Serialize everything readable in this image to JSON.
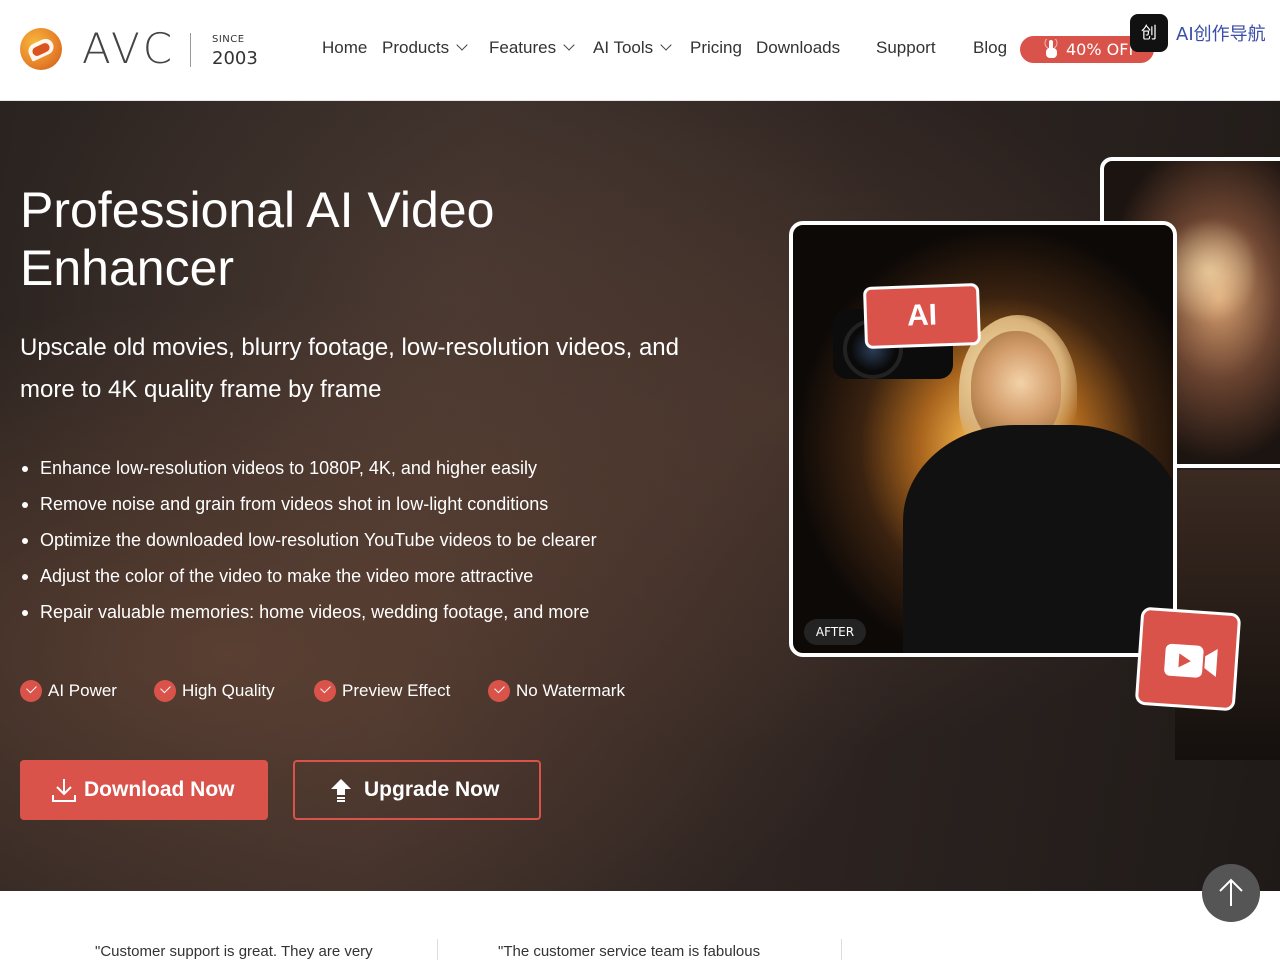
{
  "header": {
    "brand": "AVC",
    "since_label": "SINCE",
    "since_year": "2003",
    "nav": [
      {
        "label": "Home",
        "dropdown": false
      },
      {
        "label": "Products",
        "dropdown": true
      },
      {
        "label": "Features",
        "dropdown": true
      },
      {
        "label": "AI Tools",
        "dropdown": true
      },
      {
        "label": "Pricing",
        "dropdown": false
      },
      {
        "label": "Downloads",
        "dropdown": false
      },
      {
        "label": "Support",
        "dropdown": false
      },
      {
        "label": "Blog",
        "dropdown": false
      }
    ],
    "promo_label": "40% OFF",
    "partner_logo_text": "创",
    "partner_text": "AI创作导航"
  },
  "hero": {
    "title": "Professional AI Video Enhancer",
    "subtitle": "Upscale old movies, blurry footage, low-resolution videos, and more to 4K quality frame by frame",
    "bullets": [
      "Enhance low-resolution videos to 1080P, 4K, and higher easily",
      "Remove noise and grain from videos shot in low-light conditions",
      "Optimize the downloaded low-resolution YouTube videos to be clearer",
      "Adjust the color of the video to make the video more attractive",
      "Repair valuable memories: home videos, wedding footage, and more"
    ],
    "badges": [
      "AI Power",
      "High Quality",
      "Preview Effect",
      "No Watermark"
    ],
    "download_label": "Download Now",
    "upgrade_label": "Upgrade Now",
    "ai_tag": "AI",
    "after_tag": "AFTER"
  },
  "testimonials": [
    "\"Customer support is great. They are very",
    "\"The customer service team is fabulous"
  ],
  "colors": {
    "accent": "#d9534b",
    "hero_bg": "#2a2320"
  }
}
